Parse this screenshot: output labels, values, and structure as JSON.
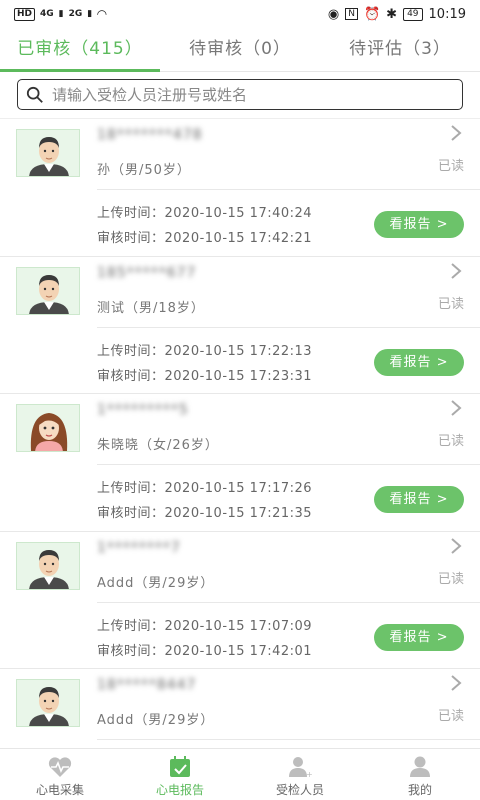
{
  "status_bar": {
    "left_hd": "HD",
    "left_sig1": "4G",
    "left_sig2": "2G",
    "battery": "49",
    "time": "10:19"
  },
  "tabs": [
    {
      "label": "已审核（415）"
    },
    {
      "label": "待审核（0）"
    },
    {
      "label": "待评估（3）"
    }
  ],
  "search": {
    "placeholder": "请输入受检人员注册号或姓名"
  },
  "records": [
    {
      "reg": "18*******478",
      "person": "孙（男/50岁）",
      "status": "已读",
      "upload": "上传时间：2020-10-15 17:40:24",
      "review": "审核时间：2020-10-15 17:42:21",
      "button": "看报告 >",
      "avatar": "male"
    },
    {
      "reg": "185*****677",
      "person": "测试（男/18岁）",
      "status": "已读",
      "upload": "上传时间：2020-10-15 17:22:13",
      "review": "审核时间：2020-10-15 17:23:31",
      "button": "看报告 >",
      "avatar": "male"
    },
    {
      "reg": "1*********5",
      "person": "朱晓晓（女/26岁）",
      "status": "已读",
      "upload": "上传时间：2020-10-15 17:17:26",
      "review": "审核时间：2020-10-15 17:21:35",
      "button": "看报告 >",
      "avatar": "female"
    },
    {
      "reg": "1********7",
      "person": "Addd（男/29岁）",
      "status": "已读",
      "upload": "上传时间：2020-10-15 17:07:09",
      "review": "审核时间：2020-10-15 17:42:01",
      "button": "看报告 >",
      "avatar": "male"
    },
    {
      "reg": "18*****8447",
      "person": "Addd（男/29岁）",
      "status": "已读",
      "upload": "",
      "review": "",
      "button": "",
      "avatar": "male"
    }
  ],
  "bottom_nav": [
    {
      "label": "心电采集",
      "icon": "heart-pulse-icon"
    },
    {
      "label": "心电报告",
      "icon": "calendar-check-icon"
    },
    {
      "label": "受检人员",
      "icon": "person-add-icon"
    },
    {
      "label": "我的",
      "icon": "user-icon"
    }
  ],
  "colors": {
    "accent": "#5cba5c",
    "button": "#6cc36a"
  }
}
